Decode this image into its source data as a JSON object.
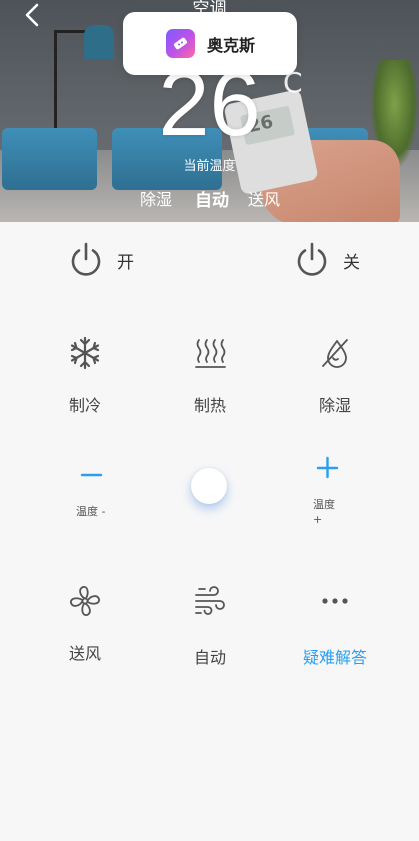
{
  "header": {
    "title": "空调",
    "current_temp": "26",
    "current_temp_label": "当前温度",
    "modes": [
      "除湿",
      "自动",
      "送风"
    ],
    "active_mode_index": 1,
    "remote_screen_value": "26",
    "partial_char": "C"
  },
  "toast": {
    "app_name": "奥克斯",
    "icon": "app-remote-icon"
  },
  "power": {
    "on_label": "开",
    "off_label": "关",
    "icon": "power-icon"
  },
  "modes_row": [
    {
      "label": "制冷",
      "icon": "snowflake-icon"
    },
    {
      "label": "制热",
      "icon": "heat-waves-icon"
    },
    {
      "label": "除湿",
      "icon": "dehumidify-icon"
    }
  ],
  "temperature": {
    "minus_label": "温度 -",
    "plus_label_line1": "温度",
    "plus_label_line2": "+"
  },
  "bottom_row": [
    {
      "label": "送风",
      "icon": "fan-icon"
    },
    {
      "label": "自动",
      "icon": "wind-icon"
    },
    {
      "label": "疑难解答",
      "icon": "more-dots-icon"
    }
  ],
  "colors": {
    "accent_blue": "#2a9ff0",
    "icon_gray": "#555555",
    "background": "#f7f7f7"
  }
}
